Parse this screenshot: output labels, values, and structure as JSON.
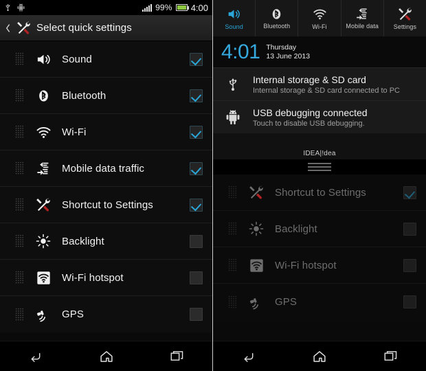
{
  "left": {
    "status_bar": {
      "icons": [
        "usb-icon",
        "android-icon"
      ],
      "battery_percent": "99%",
      "clock": "4:00",
      "signal_icon": "signal-bars-icon",
      "battery_icon": "battery-icon"
    },
    "action_bar": {
      "back_icon": "chevron-left-icon",
      "app_icon": "tools-icon",
      "title": "Select quick settings"
    },
    "list": [
      {
        "label": "Sound",
        "icon": "speaker-icon",
        "checked": true
      },
      {
        "label": "Bluetooth",
        "icon": "bluetooth-icon",
        "checked": true
      },
      {
        "label": "Wi-Fi",
        "icon": "wifi-icon",
        "checked": true
      },
      {
        "label": "Mobile data traffic",
        "icon": "mobile-data-icon",
        "checked": true
      },
      {
        "label": "Shortcut to Settings",
        "icon": "tools-icon",
        "checked": true
      },
      {
        "label": "Backlight",
        "icon": "brightness-icon",
        "checked": false
      },
      {
        "label": "Wi-Fi hotspot",
        "icon": "wifi-hotspot-icon",
        "checked": false
      },
      {
        "label": "GPS",
        "icon": "gps-satellite-icon",
        "checked": false
      }
    ],
    "nav_bar": [
      "back-icon",
      "home-icon",
      "recents-icon"
    ]
  },
  "right": {
    "tiles": [
      {
        "label": "Sound",
        "icon": "speaker-icon",
        "active": true
      },
      {
        "label": "Bluetooth",
        "icon": "bluetooth-icon",
        "active": false
      },
      {
        "label": "Wi-Fi",
        "icon": "wifi-icon",
        "active": false
      },
      {
        "label": "Mobile data",
        "icon": "mobile-data-icon",
        "active": false
      },
      {
        "label": "Settings",
        "icon": "tools-icon",
        "active": false
      }
    ],
    "shade": {
      "clock": "4:01",
      "weekday": "Thursday",
      "date": "13 June 2013",
      "notifications": [
        {
          "icon": "usb-icon",
          "title": "Internal storage & SD card",
          "subtitle": "Internal storage & SD card connected to PC"
        },
        {
          "icon": "android-icon",
          "title": "USB debugging connected",
          "subtitle": "Touch to disable USB debugging."
        }
      ],
      "carrier": "IDEA|!dea",
      "grabber_icon": "drag-handle-icon"
    },
    "list": [
      {
        "label": "Shortcut to Settings",
        "icon": "tools-icon",
        "checked": true
      },
      {
        "label": "Backlight",
        "icon": "brightness-icon",
        "checked": false
      },
      {
        "label": "Wi-Fi hotspot",
        "icon": "wifi-hotspot-icon",
        "checked": false
      },
      {
        "label": "GPS",
        "icon": "gps-satellite-icon",
        "checked": false
      }
    ],
    "nav_bar": [
      "back-icon",
      "home-icon",
      "recents-icon"
    ]
  },
  "colors": {
    "accent_blue": "#2aa6d8",
    "clock_blue": "#35a8dd",
    "battery_green": "#8dc63f",
    "panel_bg": "#0a0a0a"
  }
}
